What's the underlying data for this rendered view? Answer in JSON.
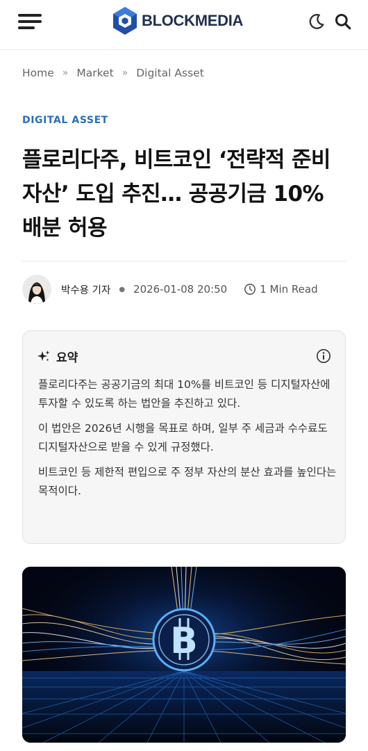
{
  "header": {
    "brand": "BLOCKMEDIA"
  },
  "breadcrumb": [
    "Home",
    "Market",
    "Digital Asset"
  ],
  "breadcrumb_sep": "»",
  "article": {
    "category": "DIGITAL ASSET",
    "title": "플로리다주, 비트코인 ‘전략적 준비자산’ 도입 추진… 공공기금 10% 배분 허용",
    "author": "박수용 기자",
    "date": "2026-01-08 20:50",
    "read_time": "1 Min Read"
  },
  "summary": {
    "title": "요약",
    "items": [
      "플로리다주는 공공기금의 최대 10%를 비트코인 등 디지털자산에 투자할 수 있도록 하는 법안을 추진하고 있다.",
      "이 법안은 2026년 시행을 목표로 하며, 일부 주 세금과 수수료도 디지털자산으로 받을 수 있게 규정했다.",
      "비트코인 등 제한적 편입으로 주 정부 자산의 분산 효과를 높인다는 목적이다."
    ]
  },
  "icons": {
    "menu": "hamburger-menu-icon",
    "theme": "moon-icon",
    "search": "search-icon",
    "sparkle": "sparkle-icon",
    "info": "info-icon",
    "clock": "clock-icon"
  },
  "colors": {
    "accent": "#2a6ebd",
    "brand_navy": "#1f2f4d",
    "summary_bg": "#f6f6f6"
  }
}
